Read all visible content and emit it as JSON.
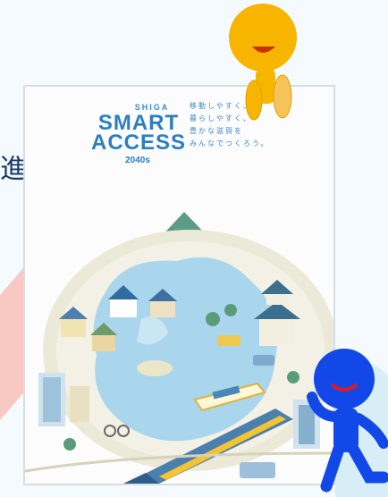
{
  "side_text": "進",
  "poster": {
    "brand_top": "SHIGA",
    "brand_line1": "SMART",
    "brand_line2": "ACCESS",
    "brand_year": "2040s",
    "tagline": [
      "移動しやすく、",
      "暮らしやすく、",
      "豊かな滋賀を",
      "みんなでつくろう。"
    ]
  },
  "colors": {
    "lake": "#a9d6ec",
    "ground": "#f1efe1",
    "brand_blue": "#2c7fbf",
    "mascot_orange": "#f7b500",
    "mascot_blue": "#1348e8"
  }
}
